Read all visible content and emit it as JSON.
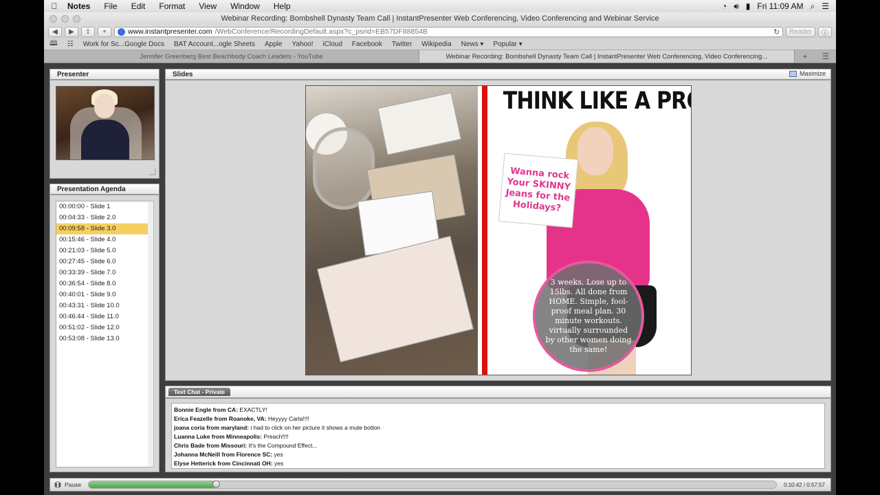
{
  "menubar": {
    "app_name": "Notes",
    "items": [
      "File",
      "Edit",
      "Format",
      "View",
      "Window",
      "Help"
    ],
    "clock": "Fri 11:09 AM"
  },
  "window": {
    "title": "Webinar Recording: Bombshell Dynasty Team Call | InstantPresenter Web Conferencing, Video Conferencing and Webinar Service"
  },
  "toolbar": {
    "url_domain": "www.instantpresenter.com",
    "url_path": "/WebConference/RecordingDefault.aspx?c_psrid=EB57DF88854B",
    "reader_label": "Reader"
  },
  "favorites": [
    "Work for Sc...Google Docs",
    "BAT Account...ogle Sheets",
    "Apple",
    "Yahoo!",
    "iCloud",
    "Facebook",
    "Twitter",
    "Wikipedia",
    "News ▾",
    "Popular ▾"
  ],
  "tabs": [
    {
      "label": "Jennifer Greenberg Best Beachbody Coach Leaders - YouTube",
      "active": false
    },
    {
      "label": "Webinar Recording: Bombshell Dynasty Team Call | InstantPresenter Web Conferencing, Video Conferencing...",
      "active": true
    }
  ],
  "presenter": {
    "heading": "Presenter"
  },
  "agenda": {
    "heading": "Presentation Agenda",
    "items": [
      "00:00:00 - Slide 1",
      "00:04:33 - Slide 2.0",
      "00:09:58 - Slide 3.0",
      "00:15:46 - Slide 4.0",
      "00:21:03 - Slide 5.0",
      "00:27:45 - Slide 6.0",
      "00:33:39 - Slide 7.0",
      "00:36:54 - Slide 8.0",
      "00:40:01 - Slide 9.0",
      "00:43:31 - Slide 10.0",
      "00:46:44 - Slide 11.0",
      "00:51:02 - Slide 12.0",
      "00:53:08 - Slide 13.0"
    ],
    "selected_index": 2
  },
  "slides": {
    "heading": "Slides",
    "maximize_label": "Maximize",
    "slide_title": "THINK LIKE A PRO!",
    "sign_text": "Wanna rock Your SKINNY Jeans for the Holidays?",
    "circle_text": "3 weeks. Lose up to 15lbs. All done from HOME. Simple, fool-proof meal plan. 30 minute workouts. virtually surrounded by other women doing the same!"
  },
  "chat": {
    "tab_label": "Text Chat - Private",
    "messages": [
      {
        "from": "Bonnie Engle from CA:",
        "text": "EXACTLY!"
      },
      {
        "from": "Erica Feazelle from Roanoke, VA:",
        "text": "Heyyyy Carla!!!!"
      },
      {
        "from": "joana coria from maryland:",
        "text": "i had to click on her picture it shows a mute botton"
      },
      {
        "from": "Luanna Luke from Minneapolis:",
        "text": "Preach!!!!"
      },
      {
        "from": "Chris Bade from Missouri:",
        "text": "It's the Compound Effect..."
      },
      {
        "from": "Johanna McNeill from Florence SC:",
        "text": "yes"
      },
      {
        "from": "Elyse Hetterick from Cincinnati OH:",
        "text": "yes"
      }
    ]
  },
  "player": {
    "pause_label": "Pause",
    "time": "0:10:42 / 0:57:57",
    "progress_fraction": 0.185
  },
  "colors": {
    "agenda_selected": "#f5cf61",
    "progress_fill": "#4da64a",
    "slide_accent": "#e0368e"
  }
}
